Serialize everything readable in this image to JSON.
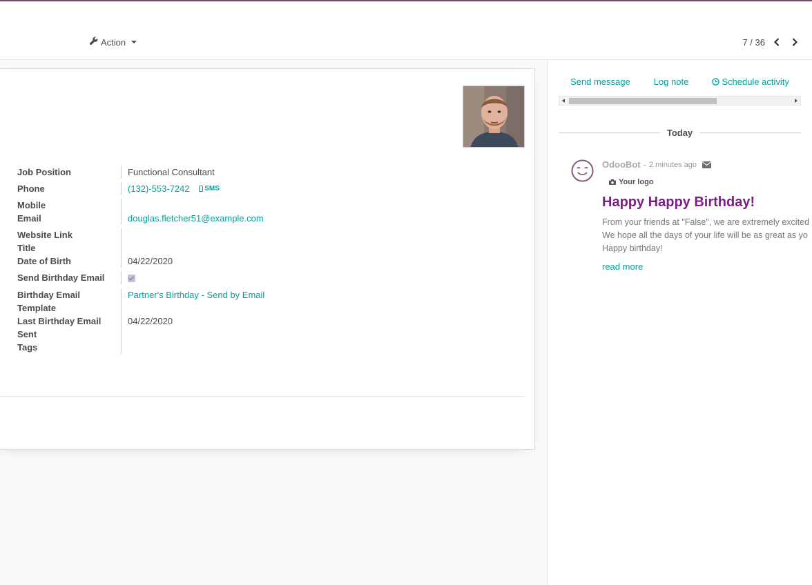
{
  "control_panel": {
    "action_label": "Action",
    "pager_value": "7 / 36"
  },
  "form": {
    "fields": [
      {
        "label": "Job Position",
        "value": "Functional Consultant",
        "type": "text"
      },
      {
        "label": "Phone",
        "value": "(132)-553-7242",
        "type": "phone",
        "extra": "SMS"
      },
      {
        "label": "Mobile",
        "value": "",
        "type": "text"
      },
      {
        "label": "Email",
        "value": "douglas.fletcher51@example.com",
        "type": "link"
      },
      {
        "label": "Website Link",
        "value": "",
        "type": "text"
      },
      {
        "label": "Title",
        "value": "",
        "type": "text"
      },
      {
        "label": "Date of Birth",
        "value": "04/22/2020",
        "type": "text"
      },
      {
        "label": "Send Birthday Email",
        "value": "",
        "type": "checkbox",
        "checked": true
      },
      {
        "label": "Birthday Email Template",
        "value": "Partner's Birthday - Send by Email",
        "type": "link"
      },
      {
        "label": "Last Birthday Email Sent",
        "value": "04/22/2020",
        "type": "text"
      },
      {
        "label": "Tags",
        "value": "",
        "type": "text"
      }
    ]
  },
  "chatter": {
    "send_message": "Send message",
    "log_note": "Log note",
    "schedule_activity": "Schedule activity",
    "today_label": "Today",
    "message": {
      "author": "OdooBot",
      "separator": "-",
      "time": "2 minutes ago",
      "logo_text": "Your logo",
      "title": "Happy Happy Birthday!",
      "lines": [
        "From your friends at \"False\", we are extremely excited",
        "We hope all the days of your life will be as great as yo",
        "Happy birthday!"
      ],
      "read_more": "read more"
    }
  },
  "colors": {
    "accent": "#00a09d",
    "brand": "#714b67",
    "title": "#7a1f85"
  }
}
